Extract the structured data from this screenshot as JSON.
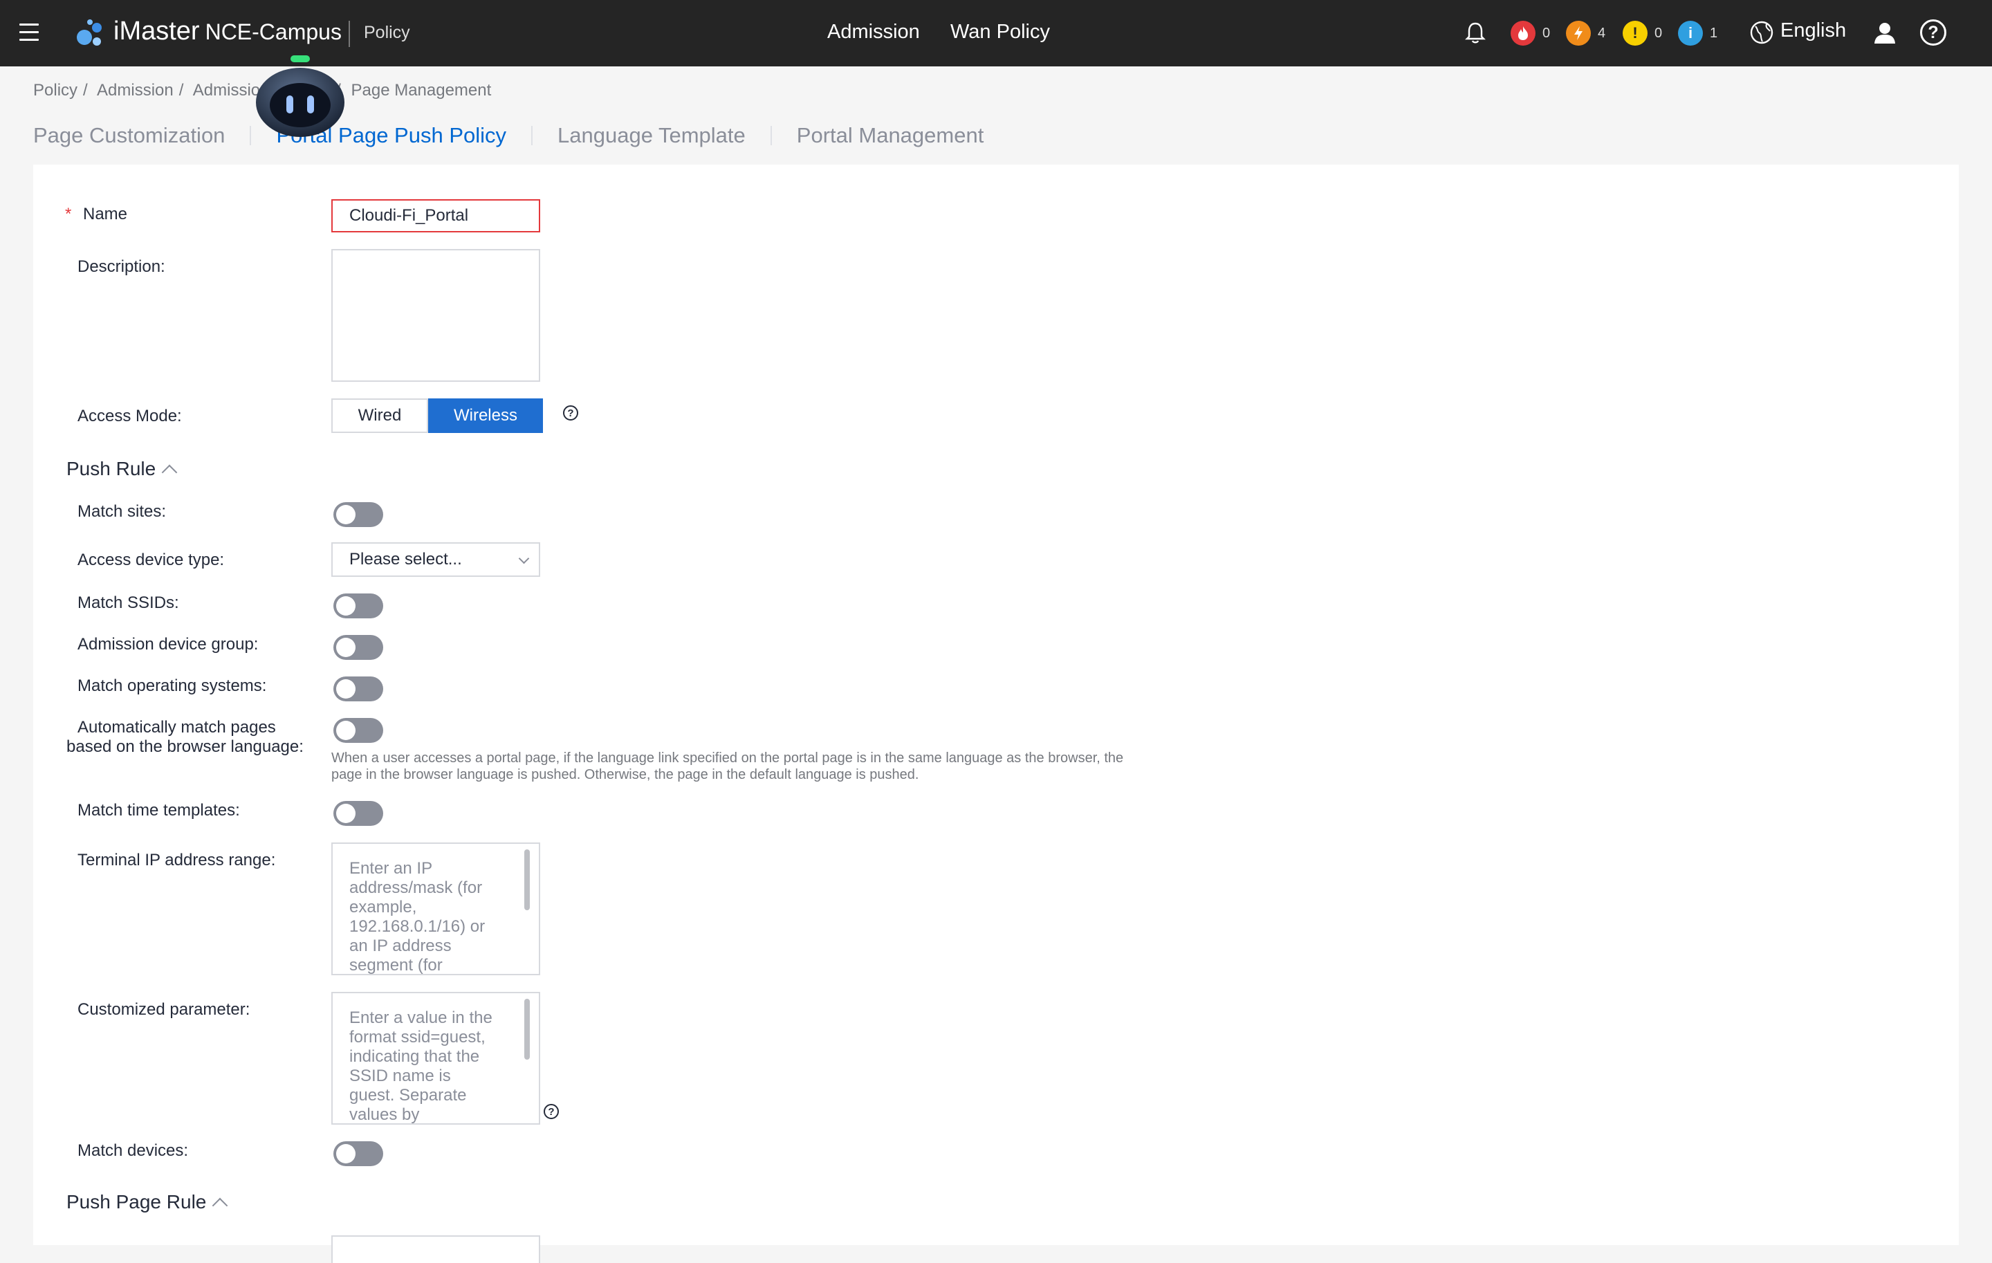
{
  "header": {
    "brand": "iMaster",
    "brand_sub": "NCE-Campus",
    "module": "Policy",
    "nav": [
      "Admission",
      "Wan Policy"
    ],
    "alarms": [
      {
        "icon": "critical-alarm-icon",
        "symbol": "🔥",
        "color": "#e4393c",
        "count": "0"
      },
      {
        "icon": "major-alarm-icon",
        "symbol": "⚡",
        "color": "#f08c1a",
        "count": "4"
      },
      {
        "icon": "minor-alarm-icon",
        "symbol": "!",
        "color": "#f7d000",
        "count": "0"
      },
      {
        "icon": "info-alarm-icon",
        "symbol": "i",
        "color": "#2f9fe0",
        "count": "1"
      }
    ],
    "language": "English"
  },
  "breadcrumb": [
    "Policy",
    "Admission",
    "Admissio",
    "",
    "Page Management"
  ],
  "tabs": [
    "Page Customization",
    "Portal Page Push Policy",
    "Language Template",
    "Portal Management"
  ],
  "active_tab": 1,
  "form": {
    "name_label": "Name",
    "name_value": "Cloudi-Fi_Portal",
    "description_label": "Description:",
    "access_mode_label": "Access Mode:",
    "access_modes": [
      "Wired",
      "Wireless"
    ],
    "access_mode_selected": "Wireless",
    "push_rule_title": "Push Rule",
    "match_sites_label": "Match sites:",
    "access_device_type_label": "Access device type:",
    "access_device_type_value": "Please select...",
    "match_ssids_label": "Match SSIDs:",
    "admission_device_group_label": "Admission device group:",
    "match_os_label": "Match operating systems:",
    "auto_match_label_1": "Automatically match pages",
    "auto_match_label_2": "based on the browser language:",
    "auto_match_hint": "When a user accesses a portal page, if the language link specified on the portal page is in the same language as the browser, the page in the browser language is pushed. Otherwise, the page in the default language is pushed.",
    "match_time_label": "Match time templates:",
    "terminal_ip_label": "Terminal IP address range:",
    "terminal_ip_placeholder": "Enter an IP address/mask (for example, 192.168.0.1/16) or an IP address segment (for",
    "custom_param_label": "Customized parameter:",
    "custom_param_placeholder": "Enter a value in the format ssid=guest, indicating that the SSID name is guest. Separate values by semicolons (;). A",
    "match_devices_label": "Match devices:",
    "push_page_rule_title": "Push Page Rule"
  },
  "colors": {
    "topbar": "#252525",
    "accent": "#0067d1",
    "selected_segment": "#1f6ed0",
    "error_border": "#e4393c",
    "toggle_off": "#8a8e99"
  }
}
